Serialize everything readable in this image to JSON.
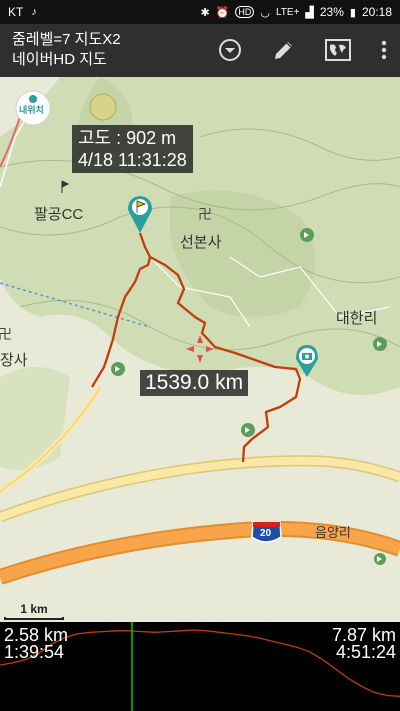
{
  "status": {
    "carrier": "KT",
    "network": "LTE+",
    "battery": "23%",
    "time": "20:18",
    "hd_badge": "HD"
  },
  "toolbar": {
    "line1": "줌레벨=7 지도X2",
    "line2": "네이버HD 지도"
  },
  "map": {
    "info": {
      "altitude": "고도 : 902 m",
      "datetime": "4/18 11:31:28"
    },
    "distance": "1539.0 km",
    "scale_label": "1 km",
    "labels": {
      "palgong": "팔공CC",
      "seonbonsa": "선본사",
      "daehanri": "대한리",
      "jangsa": "장사",
      "eumyangri": "음양리",
      "naewichi": "내위치",
      "highway": "20"
    }
  },
  "elevation": {
    "left_distance": "2.58 km",
    "left_time": "1:39:54",
    "right_distance": "7.87 km",
    "right_time": "4:51:24",
    "profile": [
      0.55,
      0.58,
      0.62,
      0.7,
      0.82,
      0.9,
      0.95,
      0.97,
      0.98,
      0.99,
      0.99,
      0.98,
      0.97,
      0.98,
      0.99,
      1.0,
      0.99,
      0.97,
      0.95,
      0.93,
      0.9,
      0.86,
      0.82,
      0.78,
      0.72,
      0.62,
      0.5,
      0.38,
      0.28,
      0.2,
      0.16,
      0.15
    ],
    "cursor": 0.33
  },
  "colors": {
    "track": "#c23c0c",
    "forest": "#cfdcb4",
    "road_major": "#f7a44b",
    "road_minor": "#fbe8a5",
    "cursor": "#00cc00"
  }
}
